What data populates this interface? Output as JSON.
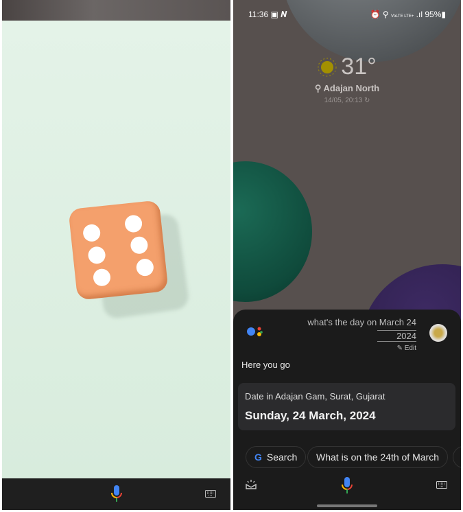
{
  "left_panel": {
    "dice_value": 6
  },
  "status_bar": {
    "time": "11:36",
    "battery": "95%",
    "network": "VoLTE LTE+"
  },
  "weather": {
    "temperature": "31°",
    "location": "Adajan North",
    "updated": "14/05, 20:13"
  },
  "assistant": {
    "query_line1": "what's the day on March 24",
    "query_line2": "2024",
    "edit_label": "Edit",
    "response": "Here you go",
    "card_label": "Date in Adajan Gam, Surat, Gujarat",
    "card_value": "Sunday, 24 March, 2024",
    "chips": [
      {
        "label": "Search"
      },
      {
        "label": "What is on the 24th of March"
      }
    ]
  },
  "colors": {
    "google_blue": "#4285f4",
    "google_red": "#ea4335",
    "google_yellow": "#fbbc05",
    "google_green": "#34a853",
    "dice": "#f4a06c"
  }
}
